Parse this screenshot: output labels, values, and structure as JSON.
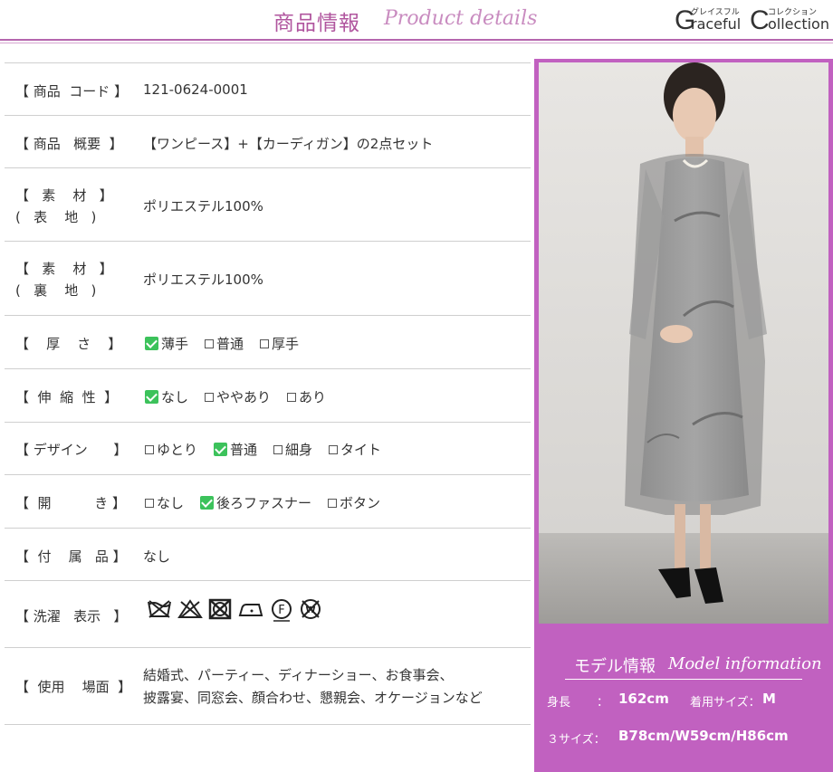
{
  "header": {
    "title": "商品情報",
    "subtitle": "Product details",
    "brand": {
      "g": "G",
      "kana1": "グレイスフル",
      "word1": "raceful",
      "c": "C",
      "kana2": "コレクション",
      "word2": "ollection"
    }
  },
  "rows": [
    {
      "label": "【 商品  コード 】",
      "value": "121-0624-0001"
    },
    {
      "label": "【 商品   概要  】",
      "value": "【ワンピース】+【カーディガン】の2点セット"
    },
    {
      "label1": "【   素    材   】",
      "label2": "(   表    地   )",
      "value": "ポリエステル100%"
    },
    {
      "label1": "【   素    材   】",
      "label2": "(   裏    地   )",
      "value": "ポリエステル100%"
    },
    {
      "label": "【    厚    さ    】",
      "options": [
        {
          "text": "薄手",
          "checked": true
        },
        {
          "text": "普通",
          "checked": false
        },
        {
          "text": "厚手",
          "checked": false
        }
      ]
    },
    {
      "label": "【  伸  縮  性  】",
      "options": [
        {
          "text": "なし",
          "checked": true
        },
        {
          "text": "ややあり",
          "checked": false
        },
        {
          "text": "あり",
          "checked": false
        }
      ]
    },
    {
      "label": "【 デザイン      】",
      "options": [
        {
          "text": "ゆとり",
          "checked": false
        },
        {
          "text": "普通",
          "checked": true
        },
        {
          "text": "細身",
          "checked": false
        },
        {
          "text": "タイト",
          "checked": false
        }
      ]
    },
    {
      "label": "【  開          き 】",
      "options": [
        {
          "text": "なし",
          "checked": false
        },
        {
          "text": "後ろファスナー",
          "checked": true
        },
        {
          "text": "ボタン",
          "checked": false
        }
      ]
    },
    {
      "label": "【  付    属   品 】",
      "value": "なし"
    },
    {
      "label": "【 洗濯   表示   】",
      "care_icons": [
        "no-wash-icon",
        "no-bleach-icon",
        "no-tumble-dry-icon",
        "iron-low-icon",
        "dry-clean-f-icon",
        "no-wet-clean-icon"
      ]
    },
    {
      "label": "【  使用    場面  】",
      "value1": "結婚式、パーティー、ディナーショー、お食事会、",
      "value2": "披露宴、同窓会、顔合わせ、懇親会、オケージョンなど"
    }
  ],
  "model": {
    "title": "モデル情報",
    "subtitle": "Model information",
    "height_label": "身長",
    "height_sep": "：",
    "height_value": "162cm",
    "size_label": "着用サイズ：",
    "size_value": "M",
    "three_size_label": "３サイズ：",
    "three_size_value": "B78cm/W59cm/H86cm"
  },
  "colors": {
    "accent": "#c161c0",
    "header": "#b0559e",
    "check": "#3cc25b"
  }
}
